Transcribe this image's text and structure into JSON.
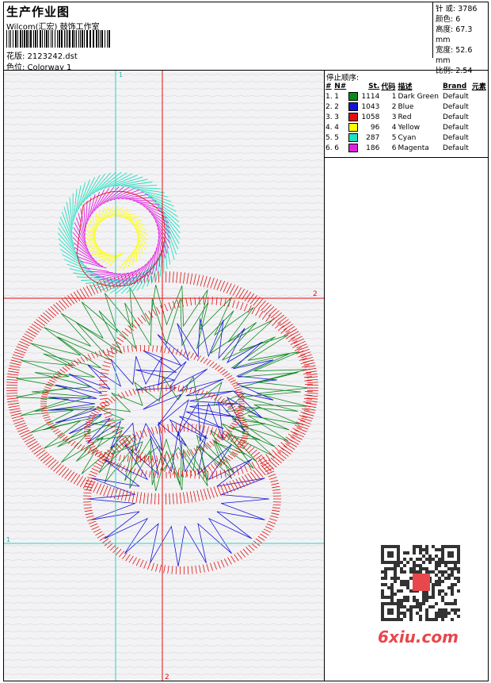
{
  "header": {
    "title": "生产作业图",
    "company": "Wilcom(汇宏) 鼓饰工作室",
    "design": "花版: 2123242.dst",
    "colorway": "色位: Colorway 1"
  },
  "stats": {
    "stitches": "针 或: 3786",
    "colors": "颜色: 6",
    "height": "高度: 67.3 mm",
    "width": "宽度: 52.6 mm",
    "scale": "比例: 2.54"
  },
  "stop_sequence": {
    "title": "停止顺序:",
    "columns": [
      "#",
      "N#",
      "St.",
      "代码",
      "描述",
      "Brand",
      "元素"
    ],
    "rows": [
      {
        "idx": "1.",
        "num": "1",
        "color": "#0a8a1e",
        "st": "1114",
        "code": "1",
        "desc": "Dark Green",
        "brand": "Default"
      },
      {
        "idx": "2.",
        "num": "2",
        "color": "#1414d8",
        "st": "1043",
        "code": "2",
        "desc": "Blue",
        "brand": "Default"
      },
      {
        "idx": "3.",
        "num": "3",
        "color": "#e01010",
        "st": "1058",
        "code": "3",
        "desc": "Red",
        "brand": "Default"
      },
      {
        "idx": "4.",
        "num": "4",
        "color": "#ffff00",
        "st": "96",
        "code": "4",
        "desc": "Yellow",
        "brand": "Default"
      },
      {
        "idx": "5.",
        "num": "5",
        "color": "#20e0c0",
        "st": "287",
        "code": "5",
        "desc": "Cyan",
        "brand": "Default"
      },
      {
        "idx": "6.",
        "num": "6",
        "color": "#e020e0",
        "st": "186",
        "code": "6",
        "desc": "Magenta",
        "brand": "Default"
      }
    ]
  },
  "guides": {
    "label_1": "1",
    "label_2": "2"
  },
  "watermark": {
    "text": "6xiu.com"
  }
}
